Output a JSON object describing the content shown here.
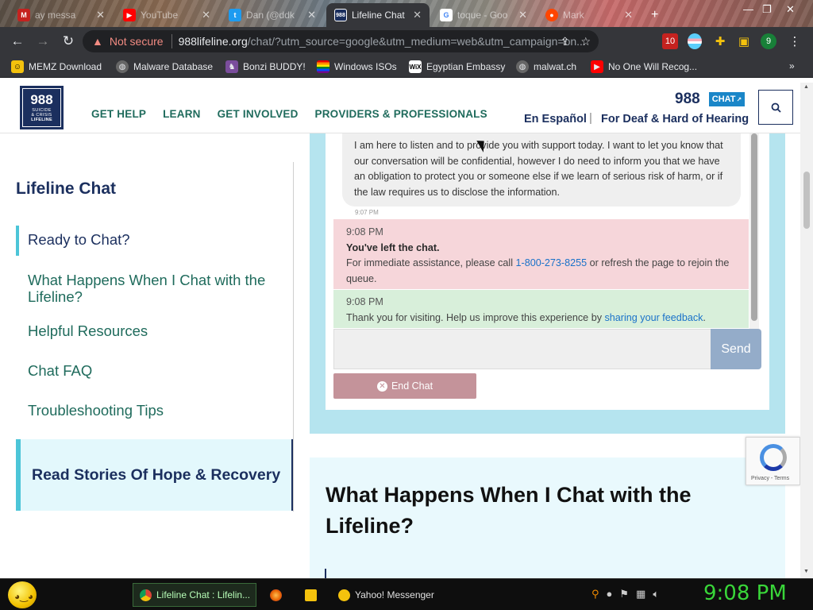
{
  "browser": {
    "tabs": [
      {
        "label": "ay messa",
        "icon": "gmail-icon",
        "active": false
      },
      {
        "label": "YouTube",
        "icon": "youtube-icon",
        "active": false
      },
      {
        "label": "Dan (@ddk",
        "icon": "twitter-icon",
        "active": false
      },
      {
        "label": "Lifeline Chat",
        "icon": "988-icon",
        "active": true
      },
      {
        "label": "toque - Goo",
        "icon": "google-icon",
        "active": false
      },
      {
        "label": "Mark",
        "icon": "reddit-icon",
        "active": false
      }
    ],
    "new_tab": "+",
    "not_secure": "Not secure",
    "url_host": "988lifeline.org",
    "url_rest": "/chat/?utm_source=google&utm_medium=web&utm_campaign=on...",
    "extension_badge": "10",
    "profile_initial": "9",
    "bookmarks": [
      {
        "label": "MEMZ Download",
        "icon": "memz-icon"
      },
      {
        "label": "Malware Database",
        "icon": "globe-icon"
      },
      {
        "label": "Bonzi BUDDY!",
        "icon": "bonzi-icon"
      },
      {
        "label": "Windows ISOs",
        "icon": "windows-icon"
      },
      {
        "label": "Egyptian Embassy",
        "icon": "wix-icon"
      },
      {
        "label": "malwat.ch",
        "icon": "globe-icon"
      },
      {
        "label": "No One Will Recog...",
        "icon": "youtube-icon"
      }
    ],
    "bookmarks_more": "»"
  },
  "site": {
    "logo": {
      "number": "988",
      "line1": "SUICIDE",
      "line2": "& CRISIS",
      "line3": "LIFELINE"
    },
    "nav": [
      "GET HELP",
      "LEARN",
      "GET INVOLVED",
      "PROVIDERS & PROFESSIONALS"
    ],
    "brand_number": "988",
    "chat_button": "CHAT",
    "spanish": "En Español",
    "lang_sep": "|",
    "deaf": "For Deaf & Hard of Hearing"
  },
  "sidebar": {
    "title": "Lifeline Chat",
    "items": [
      {
        "label": "Ready to Chat?",
        "active": true
      },
      {
        "label": "What Happens When I Chat with the Lifeline?",
        "active": false
      },
      {
        "label": "Helpful Resources",
        "active": false
      },
      {
        "label": "Chat FAQ",
        "active": false
      },
      {
        "label": "Troubleshooting Tips",
        "active": false
      }
    ],
    "stories": "Read Stories Of Hope & Recovery"
  },
  "chat": {
    "counselor_message": "I am here to listen and to provide you with support today. I want to let you know that our conversation will be confidential, however I do need to inform you that we have an obligation to protect you or someone else if we learn of serious risk of harm, or if the law requires us to disclose the information.",
    "counselor_time": "9:07 PM",
    "left_time": "9:08 PM",
    "left_title": "You've left the chat.",
    "left_text_before": "For immediate assistance, please call ",
    "left_phone": "1-800-273-8255",
    "left_text_after": " or refresh the page to rejoin the queue.",
    "thanks_time": "9:08 PM",
    "thanks_text": "Thank you for visiting. Help us improve this experience by ",
    "thanks_link": "sharing your feedback",
    "thanks_end": ".",
    "send_label": "Send",
    "end_chat_label": "End Chat"
  },
  "section": {
    "title": "What Happens When I Chat with the Lifeline?"
  },
  "recaptcha": {
    "text": "Privacy - Terms"
  },
  "taskbar": {
    "tasks": [
      {
        "label": "Lifeline Chat : Lifelin...",
        "icon": "chrome-icon",
        "active": true
      },
      {
        "label": "",
        "icon": "firefox-icon",
        "active": false
      },
      {
        "label": "",
        "icon": "folder-icon",
        "active": false
      },
      {
        "label": "Yahoo! Messenger",
        "icon": "yahoo-messenger-icon",
        "active": false
      }
    ],
    "clock": "9:08 PM"
  },
  "colors": {
    "accent_teal": "#1f6b5c",
    "navy": "#1b2f5e",
    "chat_frame": "#b5e4ef",
    "left_chat_bg": "#f6d6da",
    "thanks_bg": "#d8efda",
    "clock_green": "#39d639"
  }
}
